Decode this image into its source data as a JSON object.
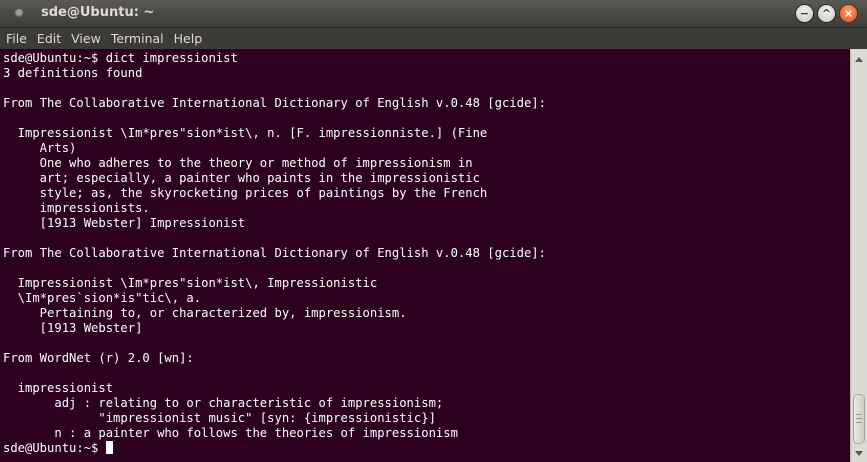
{
  "window": {
    "title": "sde@Ubuntu: ~",
    "buttons": {
      "minimize_glyph": "−",
      "maximize_glyph": "^",
      "close_glyph": "×"
    }
  },
  "menu": [
    "File",
    "Edit",
    "View",
    "Terminal",
    "Help"
  ],
  "terminal": {
    "colors": {
      "background": "#2c001e",
      "foreground": "#ffffff"
    },
    "lines": [
      "sde@Ubuntu:~$ dict impressionist",
      "3 definitions found",
      "",
      "From The Collaborative International Dictionary of English v.0.48 [gcide]:",
      "",
      "  Impressionist \\Im*pres\"sion*ist\\, n. [F. impressionniste.] (Fine",
      "     Arts)",
      "     One who adheres to the theory or method of impressionism in",
      "     art; especially, a painter who paints in the impressionistic",
      "     style; as, the skyrocketing prices of paintings by the French",
      "     impressionists.",
      "     [1913 Webster] Impressionist",
      "",
      "From The Collaborative International Dictionary of English v.0.48 [gcide]:",
      "",
      "  Impressionist \\Im*pres\"sion*ist\\, Impressionistic",
      "  \\Im*pres`sion*is\"tic\\, a.",
      "     Pertaining to, or characterized by, impressionism.",
      "     [1913 Webster]",
      "",
      "From WordNet (r) 2.0 [wn]:",
      "",
      "  impressionist",
      "       adj : relating to or characteristic of impressionism;",
      "             \"impressionist music\" [syn: {impressionistic}]",
      "       n : a painter who follows the theories of impressionism"
    ],
    "prompt": "sde@Ubuntu:~$ "
  }
}
